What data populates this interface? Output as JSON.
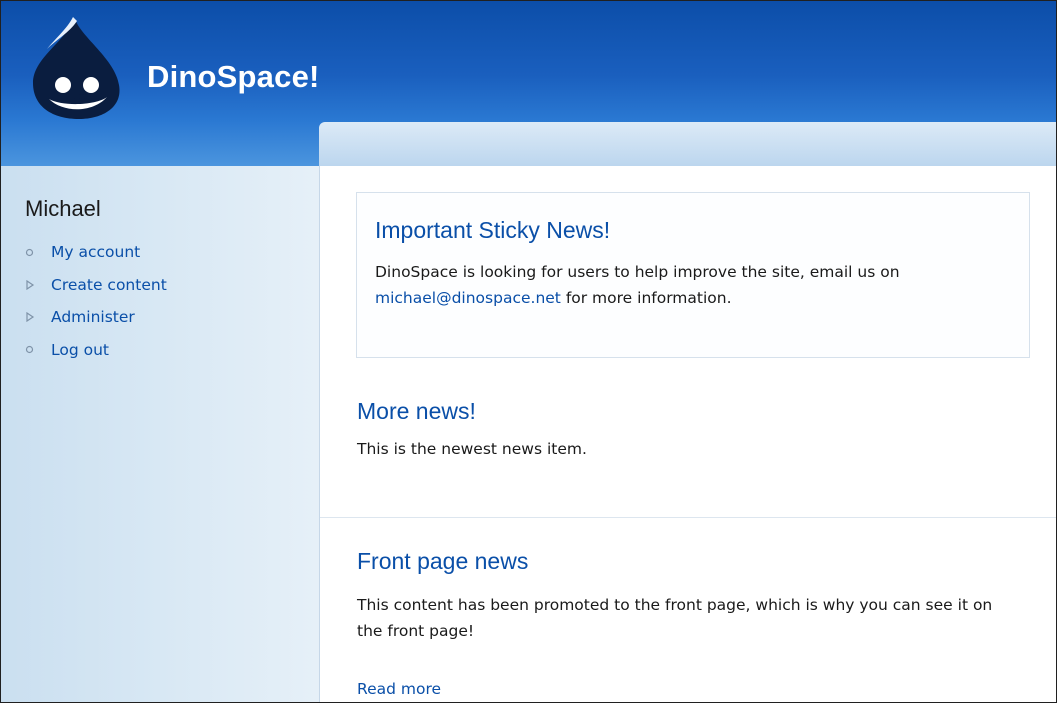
{
  "header": {
    "site_name": "DinoSpace!",
    "logo_icon": "drupal-drop-logo-icon",
    "colors": {
      "header_dark": "#0c4ea9",
      "header_light": "#4b95de",
      "link": "#0a4fa8"
    }
  },
  "sidebar": {
    "title": "Michael",
    "items": [
      {
        "label": "My account",
        "icon": "circle-bullet-icon"
      },
      {
        "label": "Create content",
        "icon": "triangle-bullet-icon"
      },
      {
        "label": "Administer",
        "icon": "triangle-bullet-icon"
      },
      {
        "label": "Log out",
        "icon": "circle-bullet-icon"
      }
    ]
  },
  "main": {
    "sticky": {
      "title": "Important Sticky News!",
      "body_before": "DinoSpace is looking for users to help improve the site, email us on ",
      "email": "michael@dinospace.net",
      "body_after": " for more information."
    },
    "news": {
      "title": "More news!",
      "body": "This is the newest news item."
    },
    "front": {
      "title": "Front page news",
      "body": "This content has been promoted to the front page, which is why you can see it on the front page!",
      "read_more": "Read more"
    }
  }
}
